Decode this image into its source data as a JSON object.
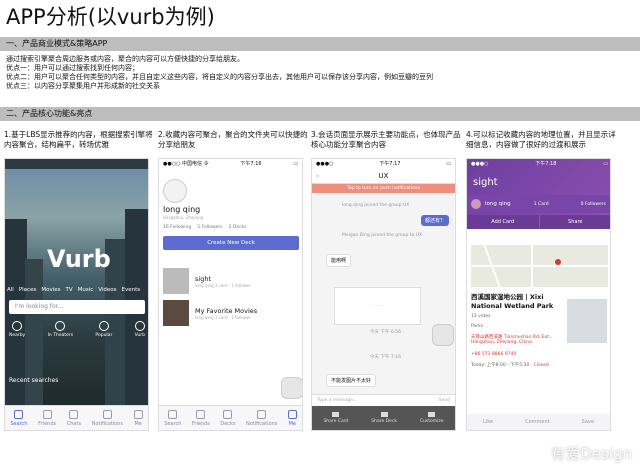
{
  "title": "APP分析(以vurb为例)",
  "sections": {
    "s1": "一、产品商业模式&策略APP",
    "s2": "二、产品核心功能&亮点"
  },
  "strategy_lines": [
    "通过搜索引擎聚合周边服务或内容，聚合的内容可以方便快捷的分享给朋友。",
    "优点一：用户可以通过搜索找到任何内容；",
    "优点二：用户可以聚合任何类型的内容，并且自定义这些内容，将自定义的内容分享出去，其他用户可以保存该分享内容，例如豆瓣的豆列",
    "优点三：以内容分享聚集用户并形成新的社交关系"
  ],
  "captions": [
    "1.基于LBS显示推荐的内容，根据搜索引擎将内容聚合，结构扁平，转场优雅",
    "2.收藏内容可聚合，聚合的文件夹可以快捷的分享给朋友",
    "3.会话页面显示展示主要功能点，也体现产品核心功能分享聚合内容",
    "4.可以标记收藏内容的地理位置，并且显示详细信息，内容做了很好的过渡和展示"
  ],
  "phone1": {
    "logo": "Vurb",
    "categories": [
      "All",
      "Places",
      "Movies",
      "TV",
      "Music",
      "Videos",
      "Events"
    ],
    "search_placeholder": "I'm looking for...",
    "icons": [
      "Nearby",
      "In Theaters",
      "Popular",
      "Vurb"
    ],
    "recent": "Recent searches",
    "tabs": [
      "Search",
      "Friends",
      "Chats",
      "Notifications",
      "Me"
    ]
  },
  "phone2": {
    "status_carrier": "●●○○ 中国电信 令",
    "status_time": "下午7:16",
    "name": "long qing",
    "sub": "Hangzhou, Zhejiang",
    "stats": [
      "16 Following",
      "5 Followers",
      "2 Decks"
    ],
    "create": "Create New Deck",
    "decks": [
      {
        "title": "sight",
        "meta": "long qing 1 card · 1 follower"
      },
      {
        "title": "My Favorite Movies",
        "meta": "long qing 1 card · 1 follower"
      }
    ],
    "tabs": [
      "Search",
      "Friends",
      "Decks",
      "Notifications",
      "Me"
    ]
  },
  "phone3": {
    "status_time": "下午7:17",
    "title": "UX",
    "banner": "Tap to turn on push notifications",
    "messages": [
      "long qing joined the group UX",
      "Meigan Bing joined the group to UX"
    ],
    "bubble_right": "都还有？",
    "bubble_left": "能用啊",
    "card_label": "- - -",
    "times": [
      "今天 下午 6:56",
      "今天 下午 7:16"
    ],
    "last_bubble": "不能发图片不太好",
    "input_placeholder": "Type a message...",
    "send": "Send",
    "actions": [
      "Share Card",
      "Share Deck",
      "Customize"
    ]
  },
  "phone4": {
    "status_time": "下午7:18",
    "title": "sight",
    "user": "long qing",
    "counts": [
      "1 Card",
      "0 Followers"
    ],
    "actions": [
      "Add Card",
      "Share"
    ],
    "place_name": "西溪国家湿地公园 | Xixi National Wetland Park",
    "rating": "12 votes",
    "category": "Parks",
    "address": "天目山路西溪路 Tianmushan Rd. Ext., Hangzhou, Zhejiang, China",
    "phone": "+86 571 8866 9740",
    "today": "Today: 上午8:00 - 下午5:30 · ",
    "closed": "Closed",
    "footer": [
      "Like",
      "Comment",
      "Save"
    ]
  },
  "watermark": "有爱Design"
}
